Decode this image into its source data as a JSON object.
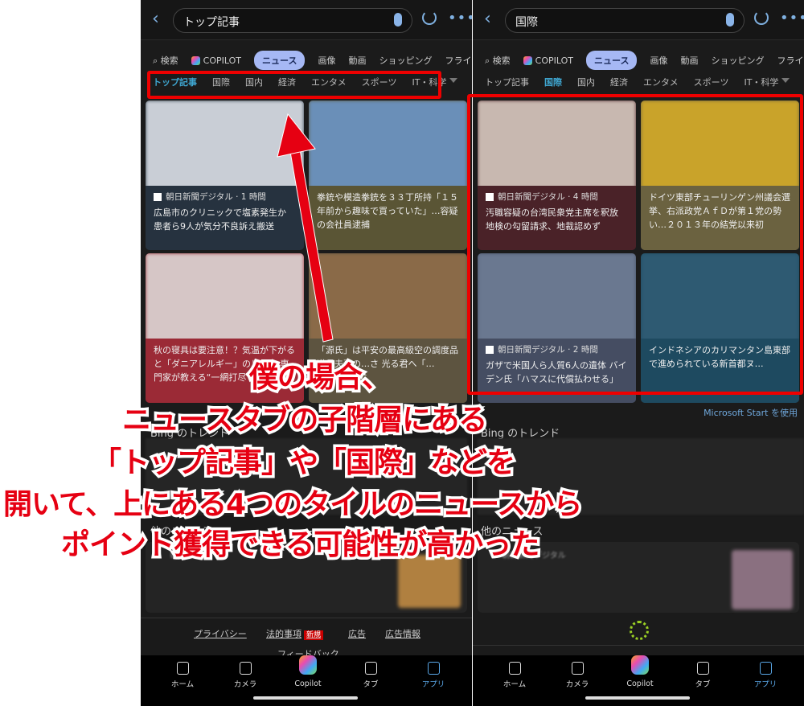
{
  "left": {
    "search_value": "トップ記事",
    "tabs": [
      "検索",
      "COPILOT",
      "ニュース",
      "画像",
      "動画",
      "ショッピング",
      "フライト"
    ],
    "subtabs": [
      "トップ記事",
      "国際",
      "国内",
      "経済",
      "エンタメ",
      "スポーツ",
      "IT・科学"
    ],
    "tiles": [
      {
        "source": "朝日新聞デジタル · 1 時間",
        "title": "広島市のクリニックで塩素発生か 患者ら9人が気分不良訴え搬送",
        "color": "#26323f",
        "img": "#c9ced6"
      },
      {
        "source": "",
        "title": "拳銃や模造拳銃を３３丁所持「１５年前から趣味で買っていた」…容疑の会社員逮捕",
        "color": "#5a5535",
        "img": "#6a8fb8"
      },
      {
        "source": "",
        "title": "秋の寝具は要注意！？気温が下がると「ダニアレルギー」のリスク 専門家が教える“一網打尽”",
        "color": "#9b2a36",
        "img": "#d6c6c6"
      },
      {
        "source": "",
        "title": "「源氏」は平安の最高級空の調度品 道長夫妻の…さ 光る君へ「…",
        "color": "#5d5440",
        "img": "#8a6a48"
      }
    ],
    "trend_title": "Bing のトレンド",
    "other_news_title": "他のニュース",
    "news_source": "毎日新聞",
    "footer": {
      "privacy": "プライバシー",
      "legal": "法的事項",
      "new_badge": "新規",
      "ads": "広告",
      "ad_info": "広告情報",
      "feedback": "フィードバック"
    }
  },
  "right": {
    "search_value": "国際",
    "tabs": [
      "検索",
      "COPILOT",
      "ニュース",
      "画像",
      "動画",
      "ショッピング",
      "フライト"
    ],
    "subtabs": [
      "トップ記事",
      "国際",
      "国内",
      "経済",
      "エンタメ",
      "スポーツ",
      "IT・科学"
    ],
    "tiles": [
      {
        "source": "朝日新聞デジタル · 4 時間",
        "title": "汚職容疑の台湾民衆党主席を釈放 地検の勾留請求、地裁認めず",
        "color": "#4a2228",
        "img": "#c8b8b0"
      },
      {
        "source": "",
        "title": "ドイツ東部チューリンゲン州議会選挙、右派政党ＡｆＤが第１党の勢い…２０１３年の結党以来初",
        "color": "#6b6240",
        "img": "#c9a32a"
      },
      {
        "source": "朝日新聞デジタル · 2 時間",
        "title": "ガザで米国人ら人質6人の遺体 バイデン氏「ハマスに代償払わせる」",
        "color": "#454d62",
        "img": "#6a7890"
      },
      {
        "source": "",
        "title": "インドネシアのカリマンタン島東部で進められている新首都ヌ…",
        "color": "#1e4a60",
        "img": "#2e5a72"
      }
    ],
    "ms_start": "Microsoft Start を使用",
    "trend_title": "Bing のトレンド",
    "other_news_title": "他のニュース",
    "news_source": "朝日新聞デジタル"
  },
  "nav": [
    "ホーム",
    "カメラ",
    "Copilot",
    "タブ",
    "アプリ"
  ],
  "annotation": [
    "僕の場合、",
    "ニュースタブの子階層にある",
    "「トップ記事」や「国際」などを",
    "開いて、上にある4つのタイルのニュースから",
    "ポイント獲得できる可能性が高かった"
  ],
  "colors": {
    "annotation": "#e60012",
    "highlight_box": "#e00000",
    "active_subtab": "#3fa6d0",
    "active_tab_bg": "#a6b8f4"
  }
}
